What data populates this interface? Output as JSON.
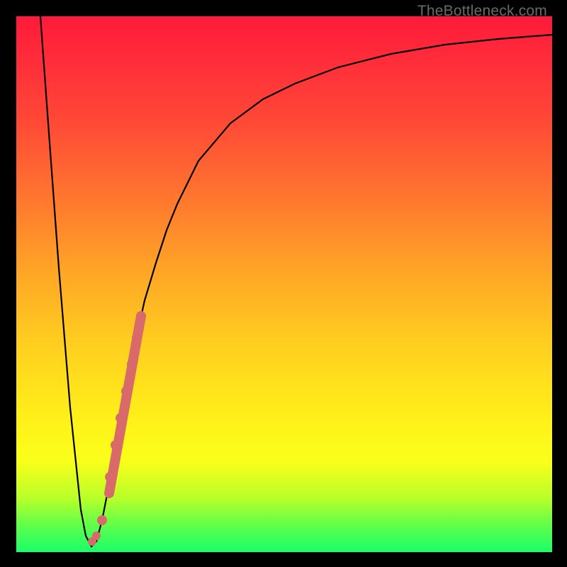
{
  "watermark": "TheBottleneck.com",
  "chart_data": {
    "type": "line",
    "title": "",
    "xlabel": "",
    "ylabel": "",
    "xlim": [
      0,
      100
    ],
    "ylim": [
      0,
      100
    ],
    "x": [
      4.5,
      6,
      8,
      10,
      12,
      13,
      14,
      15,
      16,
      18,
      20,
      22,
      24,
      26,
      28,
      30,
      34,
      40,
      46,
      52,
      60,
      70,
      80,
      90,
      100
    ],
    "values": [
      100,
      80,
      53,
      27,
      8,
      3,
      1,
      2,
      6,
      16,
      27,
      38,
      47,
      54,
      60,
      65,
      73,
      80,
      84.5,
      87.5,
      90.5,
      93,
      94.7,
      95.8,
      96.5
    ],
    "marker_points": {
      "x": [
        14.2,
        15.0,
        16.0,
        17.5,
        18.5,
        19.5,
        20.5,
        21.5,
        22.5,
        23.3
      ],
      "y": [
        2,
        3,
        6,
        14,
        20,
        25,
        30,
        35,
        40,
        44
      ]
    },
    "colors": {
      "curve": "#000000",
      "markers": "#d96a6a",
      "background_top": "#ff1a3a",
      "background_bottom": "#1aff6a"
    }
  }
}
